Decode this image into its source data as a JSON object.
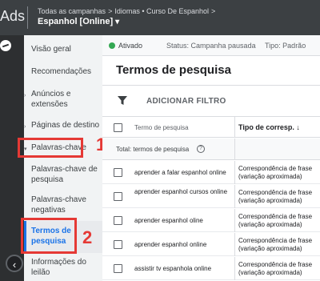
{
  "header": {
    "brand": "Ads",
    "breadcrumb_campaigns": "Todas as campanhas",
    "breadcrumb_adgroup": "Idiomas • Curso De Espanhol",
    "account_name": "Espanhol [Online]"
  },
  "sidebar": {
    "items": [
      {
        "label": "Visão geral"
      },
      {
        "label": "Recomendações"
      },
      {
        "label": "Anúncios e extensões"
      },
      {
        "label": "Páginas de destino"
      },
      {
        "label": "Palavras-chave"
      }
    ],
    "subitems": [
      {
        "label": "Palavras-chave de pesquisa"
      },
      {
        "label": "Palavras-chave negativas"
      },
      {
        "label": "Termos de pesquisa"
      },
      {
        "label": "Informações do leilão"
      }
    ]
  },
  "annotations": {
    "one": "1",
    "two": "2",
    "color": "#e53935"
  },
  "status": {
    "state": "Ativado",
    "campaign_status": "Status: Campanha pausada",
    "type": "Tipo: Padrão"
  },
  "main": {
    "title": "Termos de pesquisa",
    "add_filter": "ADICIONAR FILTRO"
  },
  "table": {
    "col_term": "Termo de pesquisa",
    "col_match": "Tipo de corresp.",
    "total_label": "Total: termos de pesquisa",
    "rows": [
      {
        "term": "aprender a falar espanhol online",
        "match": "Correspondência de frase (variação aproximada)"
      },
      {
        "term": "aprender espanhol cursos online",
        "match": "Correspondência de frase (variação aproximada)"
      },
      {
        "term": "aprender espanhol oline",
        "match": "Correspondência de frase (variação aproximada)"
      },
      {
        "term": "aprender espanhol online",
        "match": "Correspondência de frase (variação aproximada)"
      },
      {
        "term": "assistir tv espanhola online",
        "match": "Correspondência de frase (variação aproximada)"
      }
    ]
  },
  "colors": {
    "accent": "#1a73e8",
    "header_bg": "#3c4043",
    "status_active": "#34a853"
  }
}
